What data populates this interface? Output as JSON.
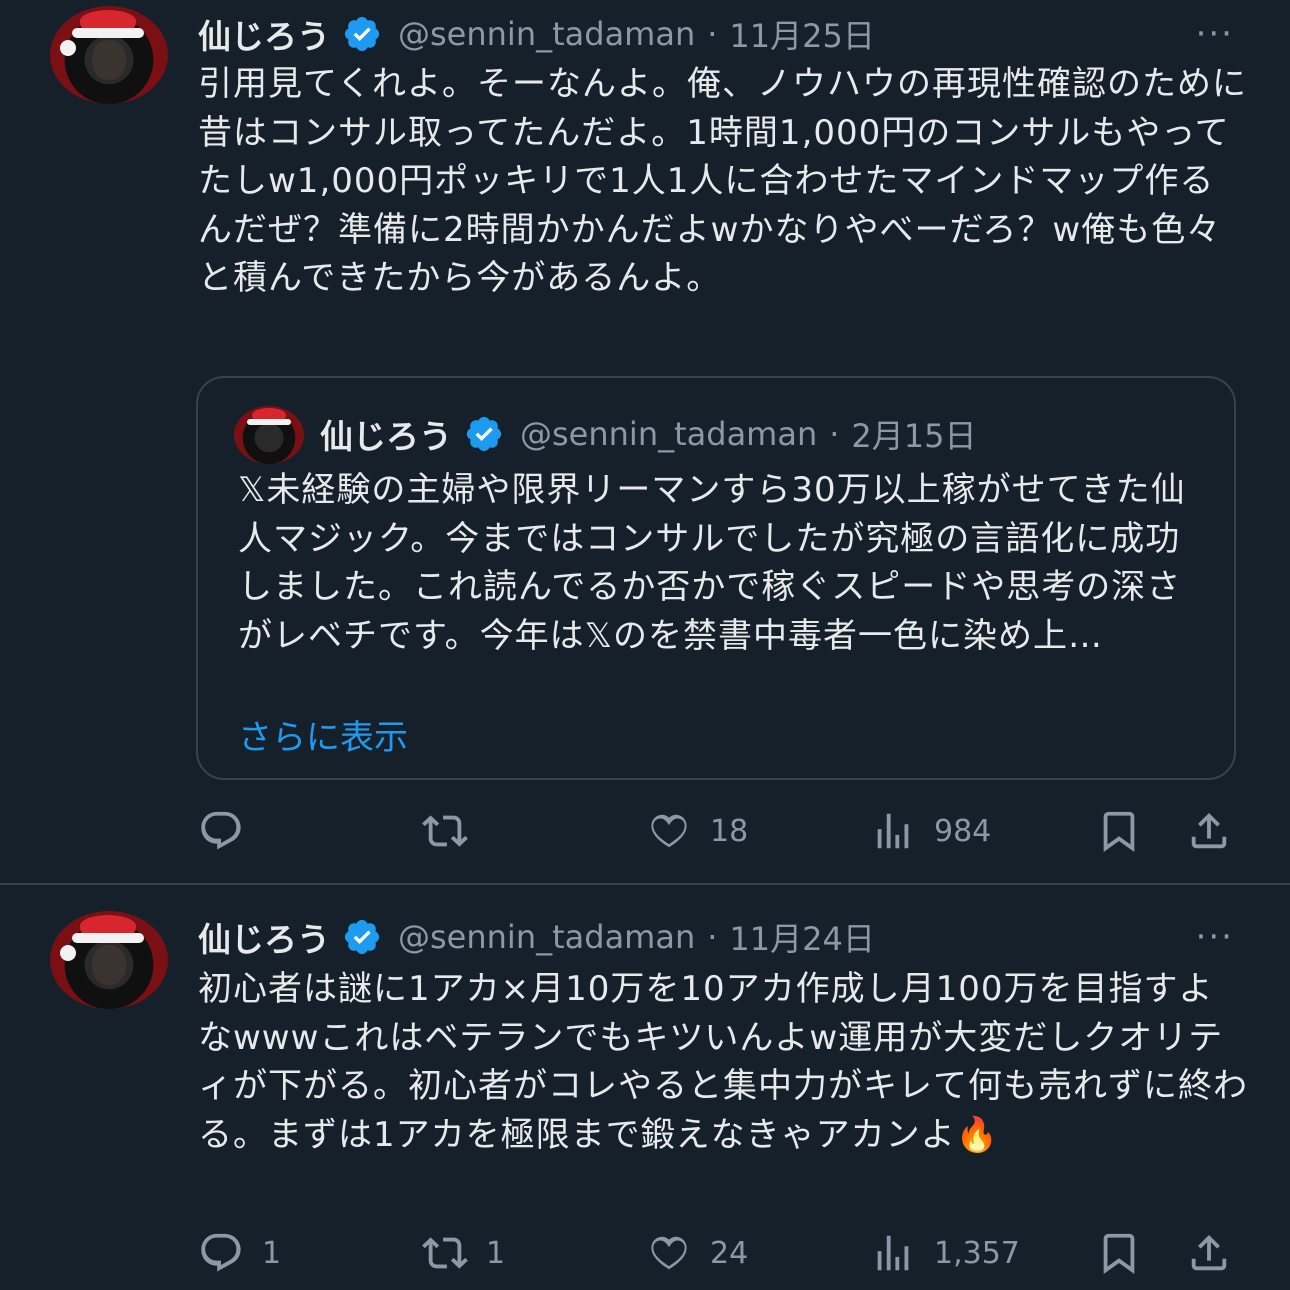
{
  "tweets": [
    {
      "name": "仙じろう",
      "handle": "@sennin_tadaman",
      "date": "11月25日",
      "separator": "·",
      "more": "···",
      "text": "引用見てくれよ。そーなんよ。俺、ノウハウの再現性確認のために昔はコンサル取ってたんだよ。1時間1,000円のコンサルもやってたしw1,000円ポッキリで1人1人に合わせたマインドマップ作るんだぜ？準備に2時間かかんだよwかなりやべーだろ？w俺も色々と積んできたから今があるんよ。",
      "quote": {
        "name": "仙じろう",
        "handle": "@sennin_tadaman",
        "date": "2月15日",
        "separator": "·",
        "text": "𝕏未経験の主婦や限界リーマンすら30万以上稼がせてきた仙人マジック。今まではコンサルでしたが究極の言語化に成功しました。これ読んでるか否かで稼ぐスピードや思考の深さがレベチです。今年は𝕏のを禁書中毒者一色に染め上…",
        "show_more": "さらに表示"
      },
      "actions": {
        "replies": "",
        "retweets": "",
        "likes": "18",
        "views": "984"
      }
    },
    {
      "name": "仙じろう",
      "handle": "@sennin_tadaman",
      "date": "11月24日",
      "separator": "·",
      "more": "···",
      "text": "初心者は謎に1アカ×月10万を10アカ作成し月100万を目指すよなwwwこれはベテランでもキツいんよw運用が大変だしクオリティが下がる。初心者がコレやると集中力がキレて何も売れずに終わる。まずは1アカを極限まで鍛えなきゃアカンよ",
      "emoji": "🔥",
      "actions": {
        "replies": "1",
        "retweets": "1",
        "likes": "24",
        "views": "1,357"
      }
    }
  ],
  "colors": {
    "background": "#15202b",
    "text": "#e7e9ea",
    "secondary": "#8b98a5",
    "accent": "#1d9bf0",
    "border": "#38444d"
  },
  "icons": [
    "reply-icon",
    "retweet-icon",
    "like-icon",
    "views-icon",
    "bookmark-icon",
    "share-icon",
    "verified-badge-icon",
    "more-icon"
  ]
}
